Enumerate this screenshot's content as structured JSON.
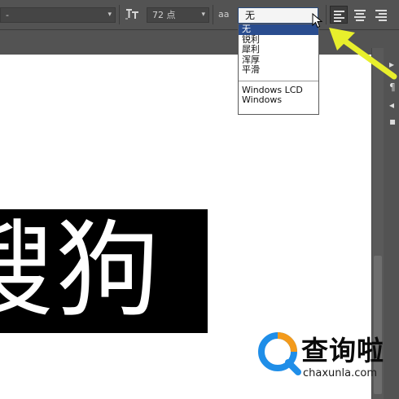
{
  "toolbar": {
    "font_style_value": "-",
    "font_size_value": "72 点",
    "aa_icon_label": "aa",
    "antialias_value": "无",
    "accent": "#2a4d8f"
  },
  "antialias_menu": {
    "options": [
      "无",
      "锐利",
      "犀利",
      "浑厚",
      "平滑"
    ],
    "system_options": [
      "Windows LCD",
      "Windows"
    ],
    "selected": "无"
  },
  "document": {
    "text": "搜狗"
  },
  "annotation": {
    "arrow_color": "#e8ef2c"
  },
  "watermark": {
    "title": "查询啦",
    "url": "chaxunla.com"
  }
}
